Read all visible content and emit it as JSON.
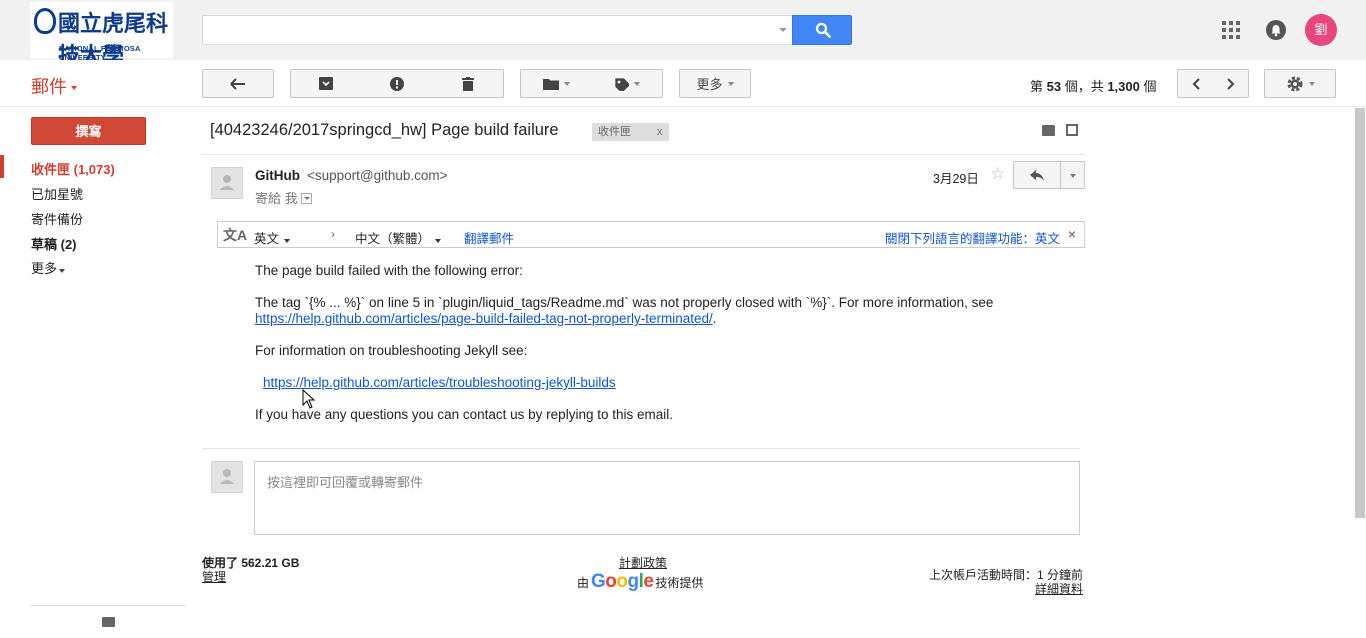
{
  "logo": {
    "chinese": "國立虎尾科技大學",
    "english": "NATIONAL FORMOSA UNIVERSITY"
  },
  "header": {
    "search_placeholder": "",
    "avatar_letter": "劉",
    "avatar_color": "#e8467c",
    "icons": [
      "search-icon",
      "apps-icon",
      "bell-icon"
    ]
  },
  "toolbar": {
    "mail_label": "郵件",
    "more_label": "更多",
    "page_prefix": "第 ",
    "page_current": "53",
    "page_mid": " 個，共 ",
    "page_total": "1,300",
    "page_suffix": " 個",
    "icons": [
      "back-icon",
      "archive-icon",
      "spam-icon",
      "delete-icon",
      "folder-icon",
      "tag-icon",
      "chevron-left-icon",
      "chevron-right-icon",
      "gear-icon"
    ]
  },
  "sidebar": {
    "compose": "撰寫",
    "inbox": "收件匣 (1,073)",
    "starred": "已加星號",
    "sent": "寄件備份",
    "drafts": "草稿 (2)",
    "more": "更多"
  },
  "thread": {
    "subject": "[40423246/2017springcd_hw] Page build failure",
    "label_chip": "收件匣",
    "label_close": "x"
  },
  "message": {
    "sender_name": "GitHub",
    "sender_email": "<support@github.com>",
    "to_line": "寄給 我",
    "date": "3月29日",
    "body": {
      "p1": "The page build failed with the following error:",
      "p2": "The tag `{% ... %}` on line 5 in `plugin/liquid_tags/Readme.md` was not properly closed with `%}`. For more information, see",
      "link1": "https://help.github.com/articles/page-build-failed-tag-not-properly-terminated/",
      "link1_suffix": ".",
      "p3": "For information on troubleshooting Jekyll see:",
      "link2": "https://help.github.com/articles/troubleshooting-jekyll-builds",
      "p4": "If you have any questions you can contact us by replying to this email."
    }
  },
  "translate": {
    "source_lang": "英文",
    "target_lang": "中文（繁體）",
    "translate_link": "翻譯郵件",
    "turn_off": "關閉下列語言的翻譯功能：英文",
    "close": "×"
  },
  "reply": {
    "placeholder": "按這裡即可回覆或轉寄郵件"
  },
  "footer": {
    "storage": "使用了 562.21 GB",
    "manage": "管理",
    "policy": "計劃政策",
    "powered_prefix": "由",
    "powered_brand": "Google",
    "powered_suffix": "技術提供",
    "last_activity": "上次帳戶活動時間：1 分鐘前",
    "details": "詳細資料"
  }
}
